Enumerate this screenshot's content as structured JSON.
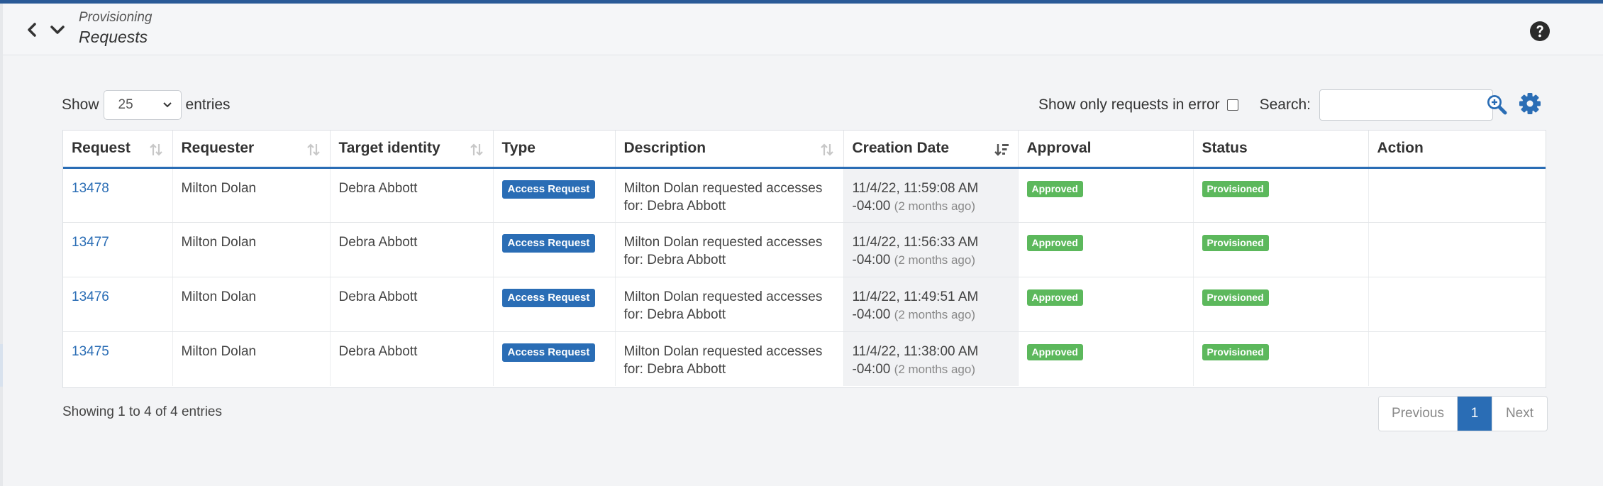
{
  "header": {
    "breadcrumb_parent": "Provisioning",
    "title": "Requests"
  },
  "controls": {
    "show_label": "Show",
    "entries_value": "25",
    "entries_label": "entries",
    "error_filter_label": "Show only requests in error",
    "search_label": "Search:",
    "search_value": ""
  },
  "table": {
    "columns": [
      "Request",
      "Requester",
      "Target identity",
      "Type",
      "Description",
      "Creation Date",
      "Approval",
      "Status",
      "Action"
    ],
    "rows": [
      {
        "request": "13478",
        "requester": "Milton Dolan",
        "target": "Debra Abbott",
        "type": "Access Request",
        "description": "Milton Dolan requested accesses for: Debra Abbott",
        "date": "11/4/22, 11:59:08 AM",
        "tz": "-04:00",
        "ago": "(2 months ago)",
        "approval": "Approved",
        "status": "Provisioned"
      },
      {
        "request": "13477",
        "requester": "Milton Dolan",
        "target": "Debra Abbott",
        "type": "Access Request",
        "description": "Milton Dolan requested accesses for: Debra Abbott",
        "date": "11/4/22, 11:56:33 AM",
        "tz": "-04:00",
        "ago": "(2 months ago)",
        "approval": "Approved",
        "status": "Provisioned"
      },
      {
        "request": "13476",
        "requester": "Milton Dolan",
        "target": "Debra Abbott",
        "type": "Access Request",
        "description": "Milton Dolan requested accesses for: Debra Abbott",
        "date": "11/4/22, 11:49:51 AM",
        "tz": "-04:00",
        "ago": "(2 months ago)",
        "approval": "Approved",
        "status": "Provisioned"
      },
      {
        "request": "13475",
        "requester": "Milton Dolan",
        "target": "Debra Abbott",
        "type": "Access Request",
        "description": "Milton Dolan requested accesses for: Debra Abbott",
        "date": "11/4/22, 11:38:00 AM",
        "tz": "-04:00",
        "ago": "(2 months ago)",
        "approval": "Approved",
        "status": "Provisioned"
      }
    ]
  },
  "footer": {
    "info": "Showing 1 to 4 of 4 entries",
    "prev_label": "Previous",
    "page": "1",
    "next_label": "Next"
  },
  "colors": {
    "accent": "#2a6db5",
    "top_border": "#2a5a97",
    "success": "#5cb85c"
  }
}
